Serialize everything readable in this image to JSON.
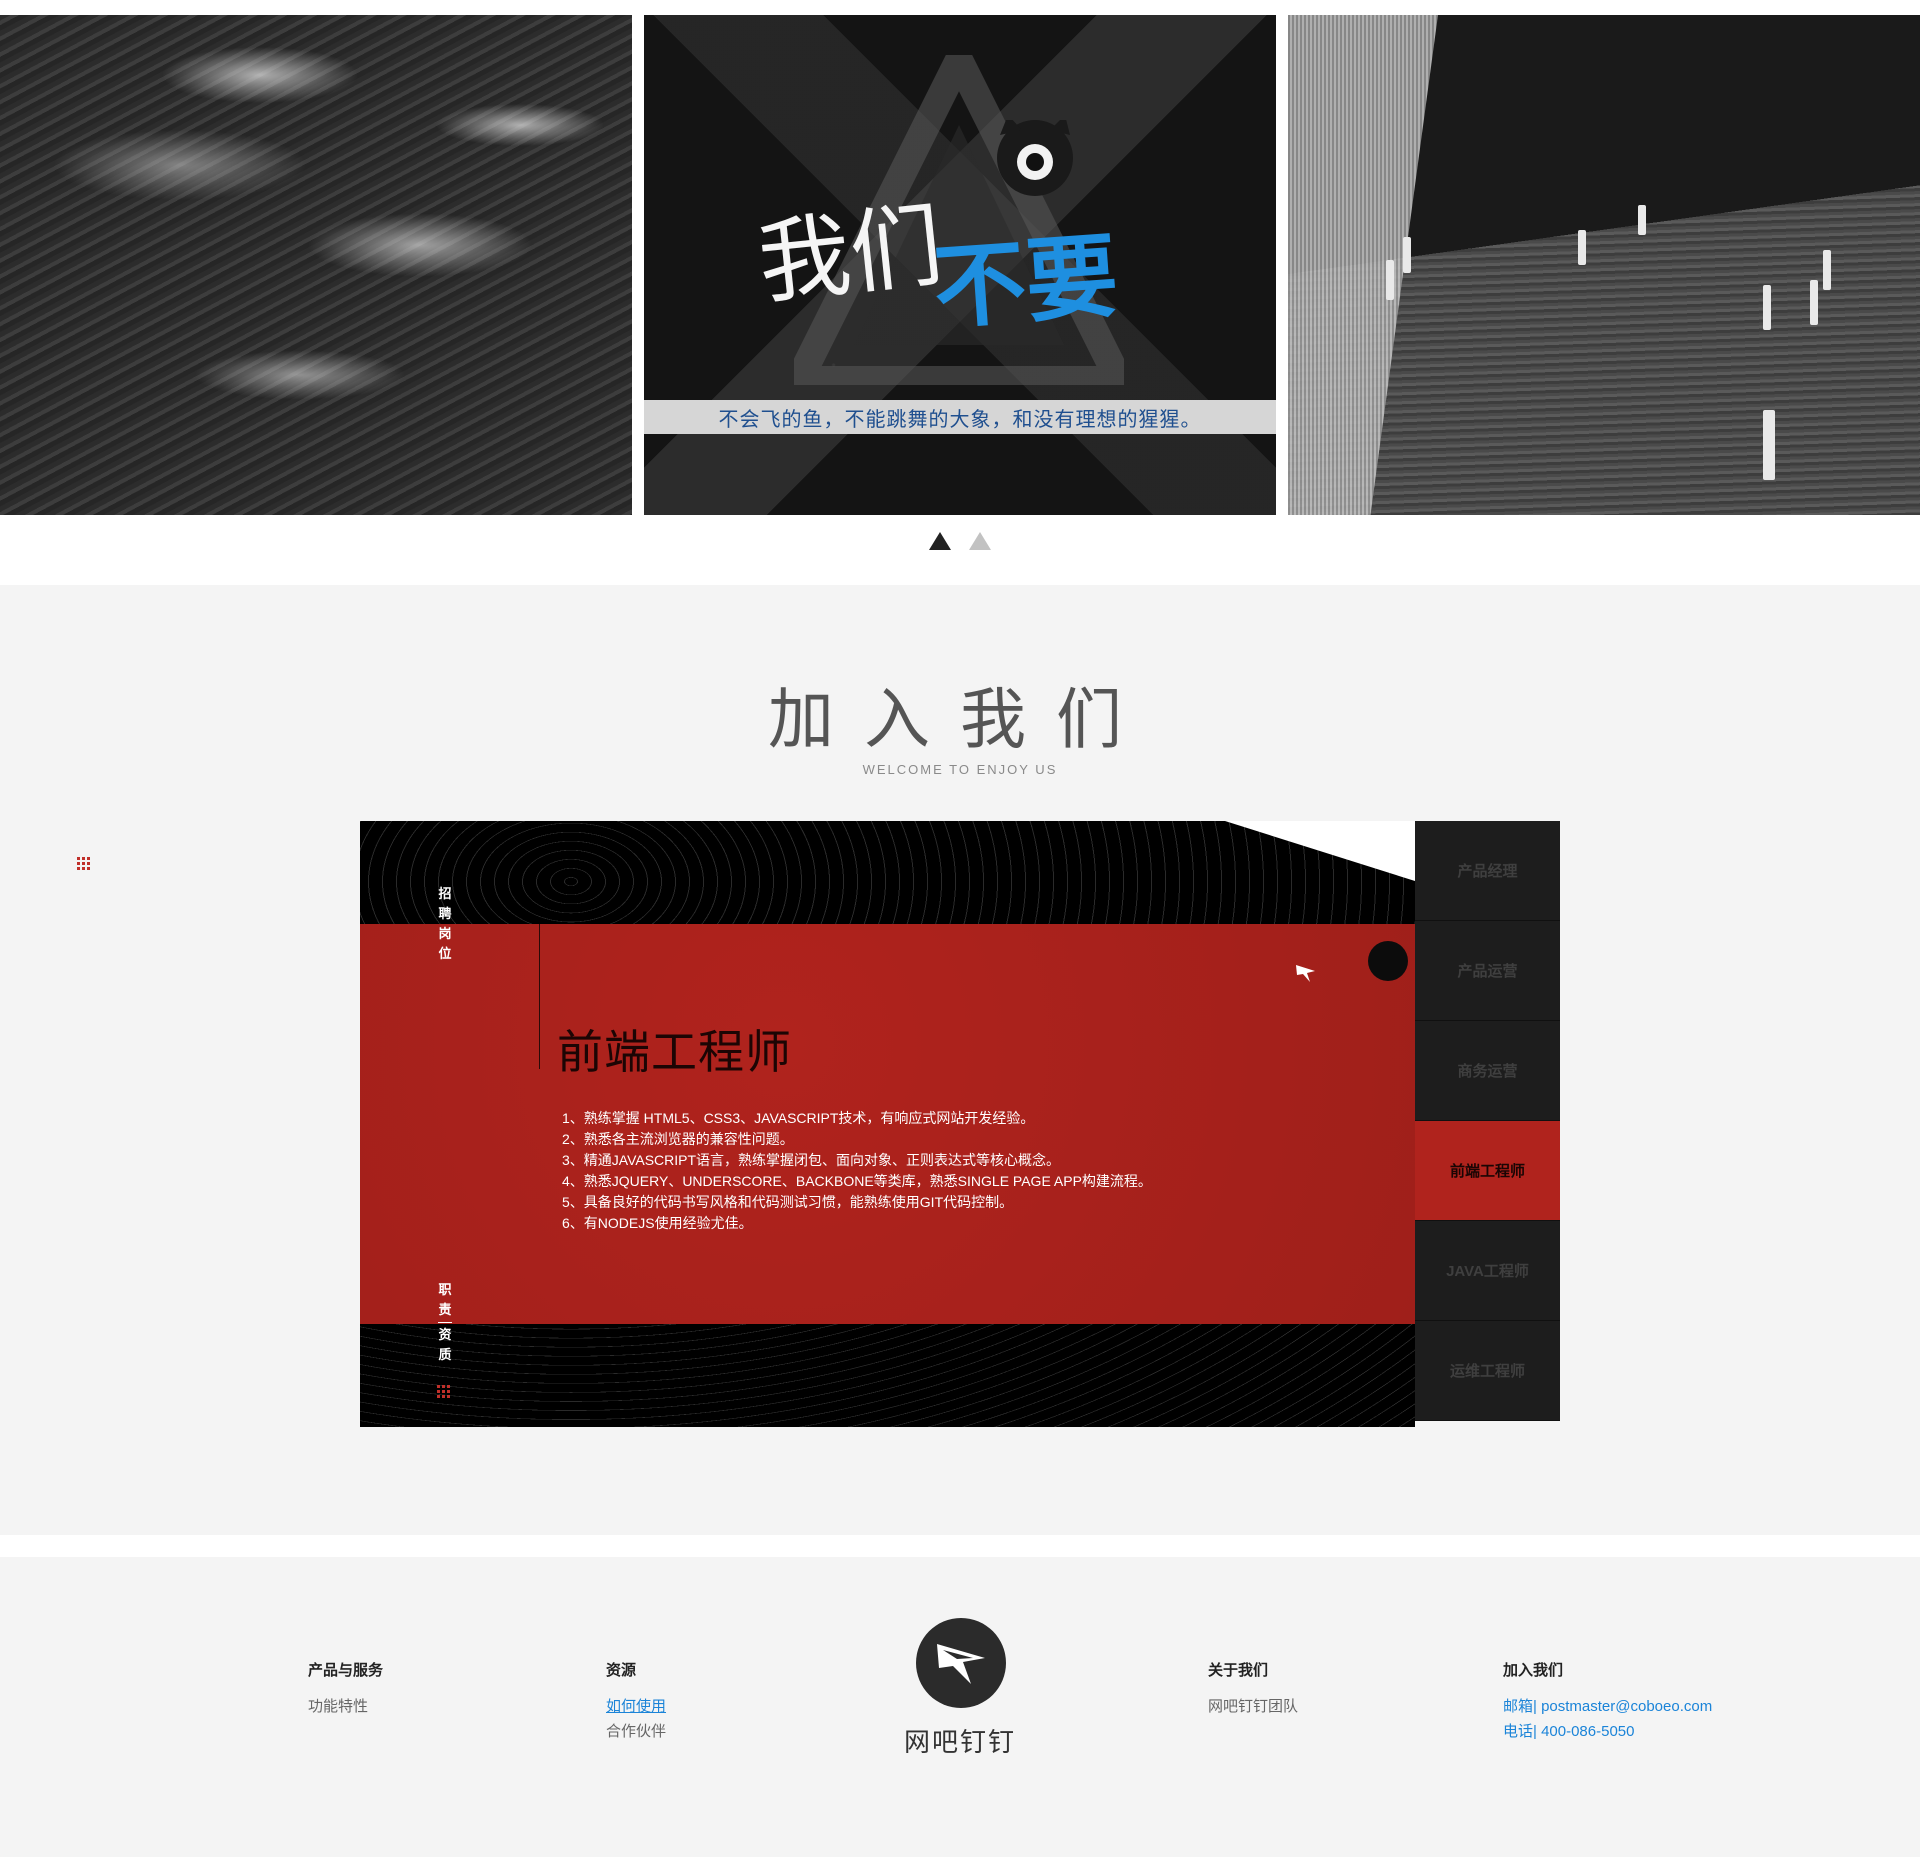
{
  "gallery": {
    "slogan_part1": "我们",
    "slogan_part2": "不要",
    "caption": "不会飞的鱼，不能跳舞的大象，和没有理想的猩猩。",
    "indicators": [
      "active",
      "inactive"
    ]
  },
  "join": {
    "title": "加入我们",
    "subtitle": "WELCOME TO ENJOY US",
    "label_positions": [
      "招",
      "聘",
      "岗",
      "位"
    ],
    "label_duties": [
      "职",
      "责",
      "资",
      "质"
    ],
    "job_title": "前端工程师",
    "requirements": [
      "1、熟练掌握 HTML5、CSS3、JAVASCRIPT技术，有响应式网站开发经验。",
      "2、熟悉各主流浏览器的兼容性问题。",
      "3、精通JAVASCRIPT语言，熟练掌握闭包、面向对象、正则表达式等核心概念。",
      "4、熟悉JQUERY、UNDERSCORE、BACKBONE等类库，熟悉SINGLE PAGE APP构建流程。",
      "5、具备良好的代码书写风格和代码测试习惯，能熟练使用GIT代码控制。",
      "6、有NODEJS使用经验尤佳。"
    ],
    "tabs": [
      {
        "label": "产品经理",
        "active": false
      },
      {
        "label": "产品运营",
        "active": false
      },
      {
        "label": "商务运营",
        "active": false
      },
      {
        "label": "前端工程师",
        "active": true
      },
      {
        "label": "JAVA工程师",
        "active": false
      },
      {
        "label": "运维工程师",
        "active": false
      }
    ],
    "accent_color": "#b0231d"
  },
  "footer": {
    "col_products": {
      "title": "产品与服务",
      "links": [
        "功能特性"
      ]
    },
    "col_resources": {
      "title": "资源",
      "links": [
        "如何使用",
        "合作伙伴"
      ]
    },
    "brand": "网吧钉钉",
    "col_about": {
      "title": "关于我们",
      "links": [
        "网吧钉钉团队"
      ]
    },
    "col_join": {
      "title": "加入我们",
      "email": "邮箱| postmaster@coboeo.com",
      "phone": "电话| 400-086-5050"
    },
    "link_color": "#1b84d8"
  }
}
